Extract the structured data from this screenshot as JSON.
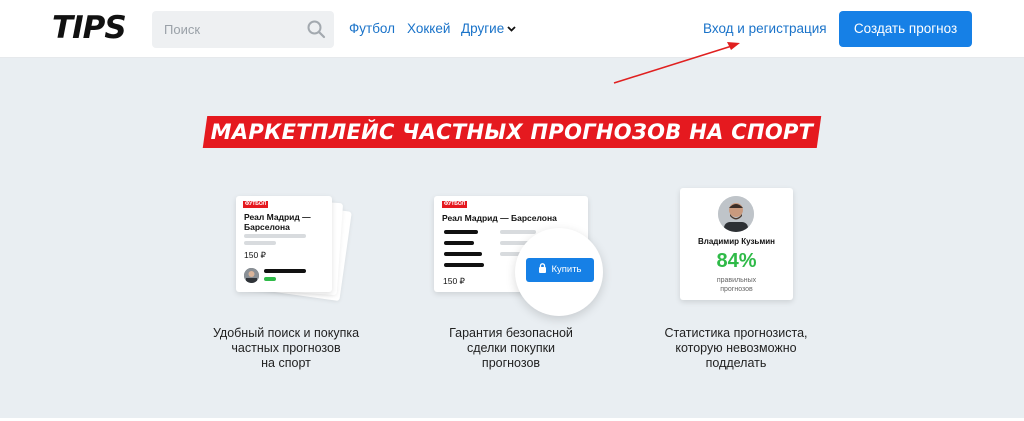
{
  "header": {
    "logo": "TIPS",
    "search_placeholder": "Поиск",
    "nav": [
      {
        "label": "Футбол"
      },
      {
        "label": "Хоккей"
      },
      {
        "label": "Другие"
      }
    ],
    "login": "Вход и регистрация",
    "create_button": "Создать прогноз"
  },
  "hero": {
    "banner": "МАРКЕТПЛЕЙС ЧАСТНЫХ ПРОГНОЗОВ НА СПОРТ"
  },
  "features": [
    {
      "card": {
        "title": "Реал Мадрид — Барселона",
        "price": "150 ₽"
      },
      "caption_lines": [
        "Удобный поиск и покупка",
        "частных прогнозов",
        "на спорт"
      ]
    },
    {
      "card": {
        "tag": "ФУТБОЛ",
        "title": "Реал Мадрид — Барселона",
        "price": "150 ₽",
        "buy_label": "Купить"
      },
      "caption_lines": [
        "Гарантия безопасной",
        "сделки покупки",
        "прогнозов"
      ]
    },
    {
      "card": {
        "name": "Владимир Кузьмин",
        "percent": "84%",
        "percent_label_lines": [
          "правильных",
          "прогнозов"
        ]
      },
      "caption_lines": [
        "Статистика прогнозиста,",
        "которую невозможно",
        "подделать"
      ]
    }
  ],
  "first_card_tag": "ФУТБОЛ",
  "colors": {
    "accent_blue": "#1680e6",
    "banner_red": "#e5191f",
    "success_green": "#2fba48",
    "main_bg": "#e9eef2"
  },
  "icons": [
    "search-icon",
    "chevron-down-icon",
    "lock-icon",
    "annotation-arrow"
  ]
}
